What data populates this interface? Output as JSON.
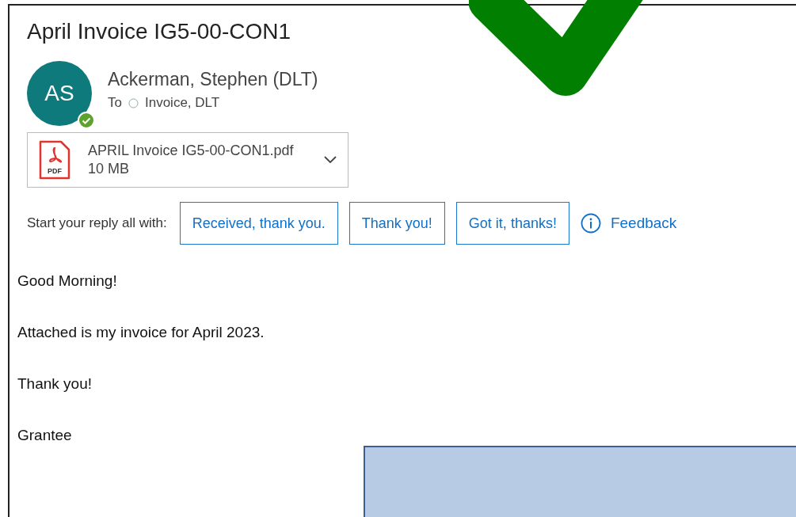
{
  "subject": "April Invoice IG5-00-CON1",
  "sender": {
    "initials": "AS",
    "name": "Ackerman, Stephen (DLT)"
  },
  "to_label": "To",
  "recipients": [
    "Invoice, DLT"
  ],
  "attachment": {
    "name": "APRIL Invoice IG5-00-CON1.pdf",
    "size": "10 MB",
    "badge": "PDF"
  },
  "reply_prompt": "Start your reply all with:",
  "suggestions": [
    "Received, thank you.",
    "Thank you!",
    "Got it, thanks!"
  ],
  "feedback": "Feedback",
  "body": [
    "Good Morning!",
    "Attached is my invoice for April 2023.",
    "Thank you!",
    "Grantee"
  ]
}
